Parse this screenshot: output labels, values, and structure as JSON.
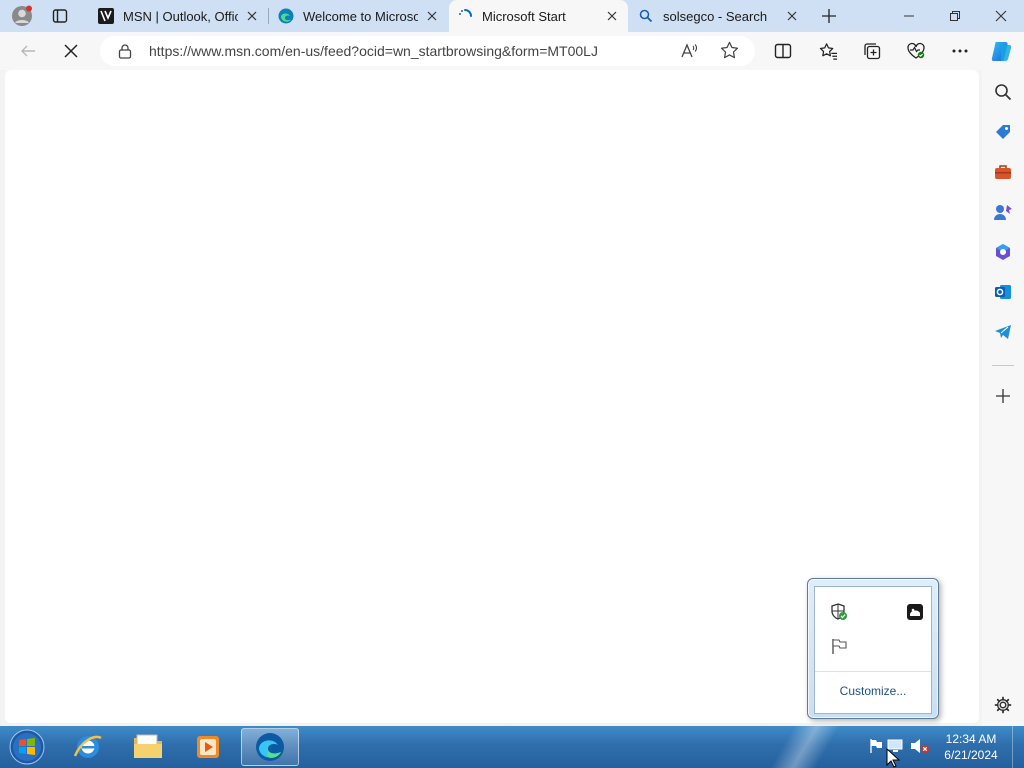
{
  "browser": {
    "tabs": [
      {
        "label": "MSN | Outlook, Office",
        "icon": "msn-icon",
        "active": false
      },
      {
        "label": "Welcome to Microsoft",
        "icon": "edge-icon",
        "active": false
      },
      {
        "label": "Microsoft Start",
        "icon": "loading-spinner-icon",
        "active": true
      },
      {
        "label": "solsegco - Search",
        "icon": "search-icon",
        "active": false
      }
    ],
    "address_url": "https://www.msn.com/en-us/feed?ocid=wn_startbrowsing&form=MT00LJ",
    "colors": {
      "tabstrip": "#cfe0f4",
      "toolbar": "#f7f7f7",
      "accent": "#0f6cbd"
    }
  },
  "sidebar": {
    "items": [
      "search-icon",
      "shopping-tag-icon",
      "tools-icon",
      "games-icon",
      "microsoft365-icon",
      "outlook-icon",
      "telegram-icon",
      "add-icon",
      "settings-icon"
    ]
  },
  "tray_popup": {
    "customize_label": "Customize..."
  },
  "taskbar": {
    "time": "12:34 AM",
    "date": "6/21/2024",
    "apps": [
      "start-orb-icon",
      "internet-explorer-icon",
      "file-explorer-icon",
      "media-player-icon",
      "edge-icon"
    ]
  }
}
